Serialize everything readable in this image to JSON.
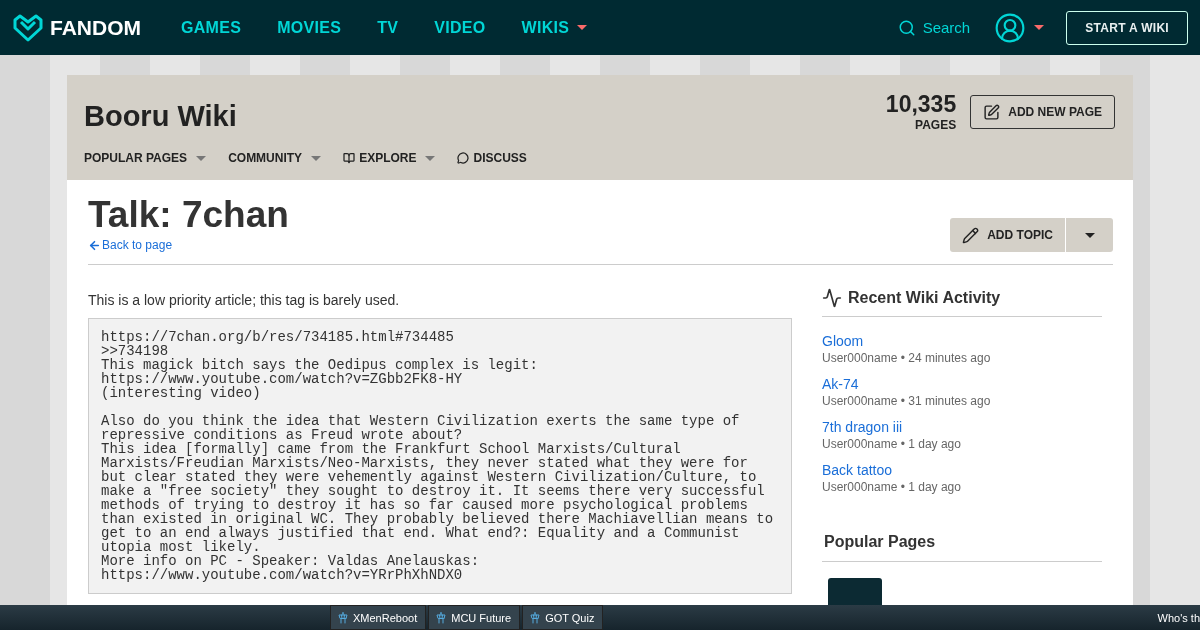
{
  "top_nav": {
    "logo": "FANDOM",
    "links": [
      {
        "label": "GAMES",
        "dropdown": false
      },
      {
        "label": "MOVIES",
        "dropdown": false
      },
      {
        "label": "TV",
        "dropdown": false
      },
      {
        "label": "VIDEO",
        "dropdown": false
      },
      {
        "label": "WIKIS",
        "dropdown": true
      }
    ],
    "search": "Search",
    "start_button": "START A WIKI"
  },
  "wiki_header": {
    "title": "Booru Wiki",
    "page_count": "10,335",
    "page_count_label": "PAGES",
    "add_button": "ADD NEW PAGE",
    "menu": [
      {
        "label": "POPULAR PAGES",
        "kind": "dropdown"
      },
      {
        "label": "COMMUNITY",
        "kind": "dropdown"
      },
      {
        "label": "EXPLORE",
        "kind": "explore"
      },
      {
        "label": "DISCUSS",
        "kind": "discuss"
      }
    ]
  },
  "page": {
    "title": "Talk: 7chan",
    "back_link": "Back to page",
    "add_topic": "ADD TOPIC",
    "notice": "This is a low priority article; this tag is barely used.",
    "code": "https://7chan.org/b/res/734185.html#734485\n>>734198\nThis magick bitch says the Oedipus complex is legit:\nhttps://www.youtube.com/watch?v=ZGbb2FK8-HY\n(interesting video)\n\nAlso do you think the idea that Western Civilization exerts the same type of\nrepressive conditions as Freud wrote about?\nThis idea [formally] came from the Frankfurt School Marxists/Cultural\nMarxists/Freudian Marxists/Neo-Marxists, they never stated what they were for\nbut clear stated they were vehemently against Western Civilization/Culture, to\nmake a \"free society\" they sought to destroy it. It seems there very successful\nmethods of trying to destroy it has so far caused more psychological problems\nthan existed in original WC. They probably believed there Machiavellian means to\nget to an end always justified that end. What end?: Equality and a Communist\nutopia most likely.\nMore info on PC - Speaker: Valdas Anelauskas:\nhttps://www.youtube.com/watch?v=YRrPhXhNDX0"
  },
  "recent_activity": {
    "title": "Recent Wiki Activity",
    "items": [
      {
        "page": "Gloom",
        "meta": "User000name • 24 minutes ago"
      },
      {
        "page": "Ak-74",
        "meta": "User000name • 31 minutes ago"
      },
      {
        "page": "7th dragon iii",
        "meta": "User000name • 1 day ago"
      },
      {
        "page": "Back tattoo",
        "meta": "User000name • 1 day ago"
      }
    ]
  },
  "popular_pages": {
    "title": "Popular Pages"
  },
  "bottom_bar": {
    "tabs": [
      {
        "label": "XMenReboot"
      },
      {
        "label": "MCU Future"
      },
      {
        "label": "GOT Quiz"
      }
    ],
    "right_text": "Who's th"
  }
}
